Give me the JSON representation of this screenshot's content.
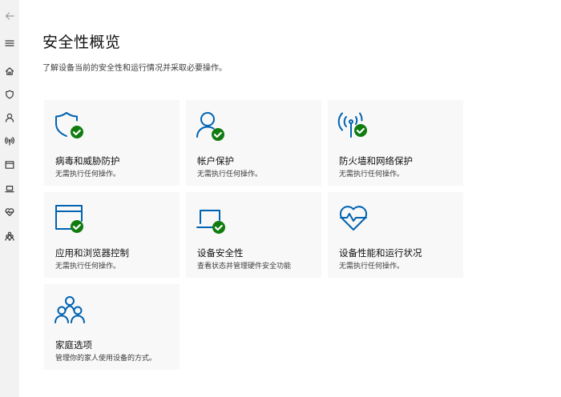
{
  "nav": {
    "items": [
      {
        "name": "back",
        "icon": "back-arrow-icon"
      },
      {
        "name": "menu",
        "icon": "hamburger-menu-icon"
      },
      {
        "name": "home",
        "icon": "home-icon"
      },
      {
        "name": "virus-protection",
        "icon": "shield-icon"
      },
      {
        "name": "account-protection",
        "icon": "person-icon"
      },
      {
        "name": "firewall",
        "icon": "antenna-icon"
      },
      {
        "name": "app-browser-control",
        "icon": "browser-window-icon"
      },
      {
        "name": "device-security",
        "icon": "laptop-icon"
      },
      {
        "name": "device-performance",
        "icon": "heart-pulse-icon"
      },
      {
        "name": "family-options",
        "icon": "family-icon"
      }
    ]
  },
  "page": {
    "title": "安全性概览",
    "subtitle": "了解设备当前的安全性和运行情况并采取必要操作。"
  },
  "tiles": [
    {
      "icon": "shield-check-icon",
      "title": "病毒和威胁防护",
      "status": "无需执行任何操作。"
    },
    {
      "icon": "person-check-icon",
      "title": "帐户保护",
      "status": "无需执行任何操作。"
    },
    {
      "icon": "antenna-check-icon",
      "title": "防火墙和网络保护",
      "status": "无需执行任何操作。"
    },
    {
      "icon": "browser-check-icon",
      "title": "应用和浏览器控制",
      "status": "无需执行任何操作。"
    },
    {
      "icon": "laptop-check-icon",
      "title": "设备安全性",
      "status": "查看状态并管理硬件安全功能"
    },
    {
      "icon": "heart-pulse-icon",
      "title": "设备性能和运行状况",
      "status": "无需执行任何操作。"
    },
    {
      "icon": "family-icon",
      "title": "家庭选项",
      "status": "管理你的家人使用设备的方式。"
    }
  ],
  "colors": {
    "accent": "#0063b1",
    "success": "#107c10",
    "tile_background": "#f8f8f8",
    "nav_background": "#f2f2f2"
  }
}
